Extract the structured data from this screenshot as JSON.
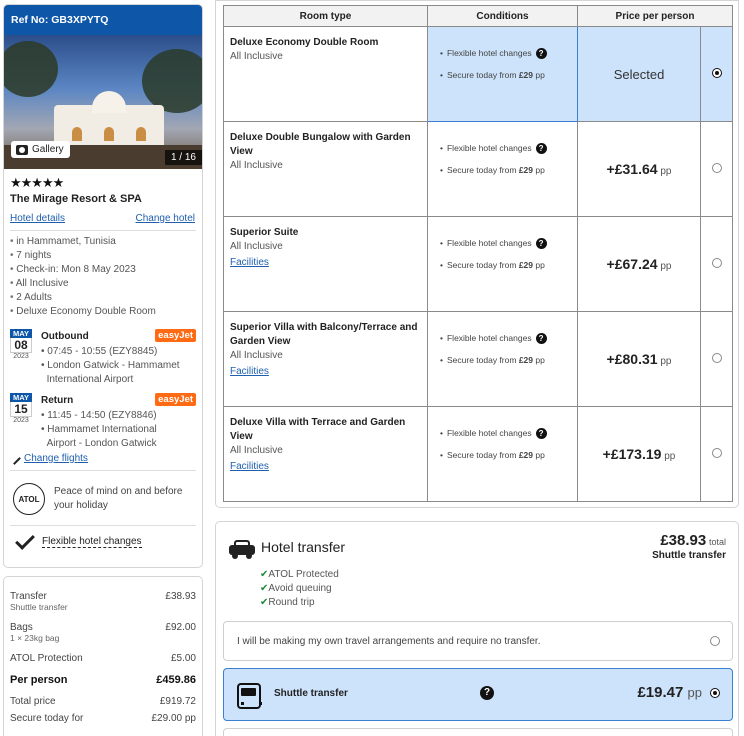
{
  "summary": {
    "ref": "Ref No: GB3XPYTQ",
    "gallery_label": "Gallery",
    "photo_count": "1 / 16",
    "stars": "★★★★★",
    "hotel_name": "The Mirage Resort & SPA",
    "hotel_details_link": "Hotel details",
    "change_hotel_link": "Change hotel",
    "details": [
      "in Hammamet, Tunisia",
      "7 nights",
      "Check-in: Mon 8 May 2023",
      "All Inclusive",
      "2 Adults",
      "Deluxe Economy Double Room"
    ],
    "outbound": {
      "month": "MAY",
      "day": "08",
      "year": "2023",
      "title": "Outbound",
      "airline": "easyJet",
      "time": "07:45 - 10:55 (EZY8845)",
      "route_1": "London Gatwick - Hammamet",
      "route_2": "International Airport"
    },
    "return": {
      "month": "MAY",
      "day": "15",
      "year": "2023",
      "title": "Return",
      "airline": "easyJet",
      "time": "11:45 - 14:50 (EZY8846)",
      "route_1": "Hammamet International",
      "route_2": "Airport - London Gatwick"
    },
    "change_flights_link": "Change flights",
    "atol_logo_text": "ATOL",
    "peace_of_mind": "Peace of mind on and before your holiday",
    "flexible_changes": "Flexible hotel changes"
  },
  "price_breakdown": {
    "transfer_label": "Transfer",
    "transfer_value": "£38.93",
    "transfer_sub": "Shuttle transfer",
    "bags_label": "Bags",
    "bags_value": "£92.00",
    "bags_sub": "1 × 23kg bag",
    "atol_label": "ATOL Protection",
    "atol_value": "£5.00",
    "per_person_label": "Per person",
    "per_person_value": "£459.86",
    "total_label": "Total price",
    "total_value": "£919.72",
    "secure_label": "Secure today for",
    "secure_value": "£29.00 pp"
  },
  "rooms": {
    "headers": [
      "Room type",
      "Conditions",
      "Price per person"
    ],
    "condition_1": "Flexible hotel changes",
    "condition_2_prefix": "Secure today from",
    "condition_2_amount": "£29",
    "condition_2_suffix": "pp",
    "pp": "pp",
    "selected_label": "Selected",
    "facilities_label": "Facilities",
    "list": [
      {
        "name": "Deluxe Economy Double Room",
        "board": "All Inclusive",
        "price": "",
        "selected": true
      },
      {
        "name": "Deluxe Double Bungalow with Garden View",
        "board": "All Inclusive",
        "price": "+£31.64",
        "selected": false
      },
      {
        "name": "Superior Suite",
        "board": "All Inclusive",
        "price": "+£67.24",
        "selected": false
      },
      {
        "name": "Superior Villa with Balcony/Terrace and Garden View",
        "board": "All Inclusive",
        "price": "+£80.31",
        "selected": false
      },
      {
        "name": "Deluxe Villa with Terrace and Garden View",
        "board": "All Inclusive",
        "price": "+£173.19",
        "selected": false
      }
    ]
  },
  "transfer": {
    "title": "Hotel transfer",
    "total_amount": "£38.93",
    "total_label": "total",
    "total_sub": "Shuttle transfer",
    "perks": [
      "ATOL Protected",
      "Avoid queuing",
      "Round trip"
    ],
    "own_arrangements": "I will be making my own travel arrangements and require no transfer.",
    "shuttle_name": "Shuttle transfer",
    "shuttle_price": "£19.47",
    "shuttle_pp": "pp"
  },
  "colors": {
    "brand_blue": "#0e56a8",
    "selected_bg": "#cde3fb",
    "easyjet_orange": "#ff6a13"
  }
}
